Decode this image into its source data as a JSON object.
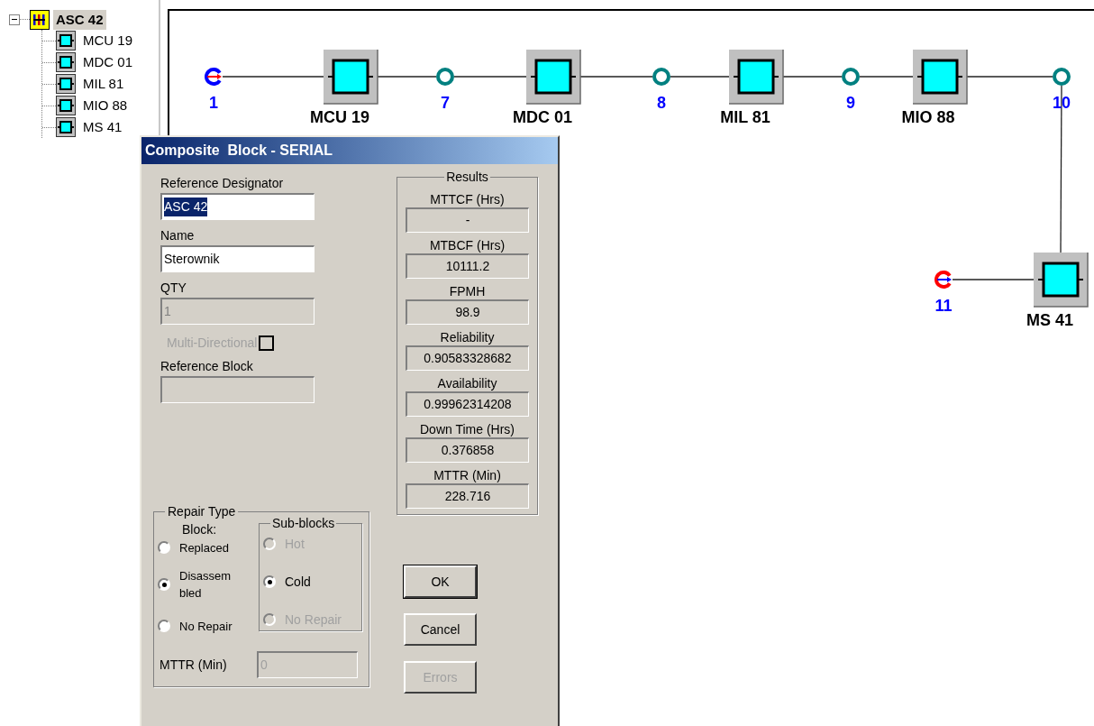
{
  "tree": {
    "label": "ASC 42",
    "expanded": true,
    "selected": true,
    "children": [
      {
        "label": "MCU 19",
        "selected": false
      },
      {
        "label": "MDC 01",
        "selected": false
      },
      {
        "label": "MIL 81",
        "selected": false
      },
      {
        "label": "MIO 88",
        "selected": false
      },
      {
        "label": "MS 41",
        "selected": false
      }
    ]
  },
  "diagram": {
    "nodes": [
      {
        "kind": "start",
        "label": "1"
      },
      {
        "kind": "block",
        "label": "MCU 19"
      },
      {
        "kind": "junction",
        "label": "7"
      },
      {
        "kind": "block",
        "label": "MDC 01"
      },
      {
        "kind": "junction",
        "label": "8"
      },
      {
        "kind": "block",
        "label": "MIL 81"
      },
      {
        "kind": "junction",
        "label": "9"
      },
      {
        "kind": "block",
        "label": "MIO 88"
      },
      {
        "kind": "junction",
        "label": "10"
      },
      {
        "kind": "block",
        "label": "MS 41"
      },
      {
        "kind": "end",
        "label": "11"
      }
    ]
  },
  "dialog": {
    "title": "Composite  Block - SERIAL",
    "fields": [
      {
        "kind": "text",
        "label": "Reference Designator",
        "value": "ASC 42",
        "highlighted": true,
        "disabled": false
      },
      {
        "kind": "text",
        "label": "Name",
        "value": "Sterownik",
        "highlighted": false,
        "disabled": false
      },
      {
        "kind": "text",
        "label": "QTY",
        "value": "1",
        "highlighted": false,
        "disabled": true
      },
      {
        "kind": "checkbox",
        "label": "Multi-Directional",
        "checked": false,
        "disabled": true
      },
      {
        "kind": "text",
        "label": "Reference Block",
        "disabled": true
      }
    ],
    "results": {
      "title": "Results",
      "items": [
        {
          "label": "MTTCF (Hrs)",
          "value": "-"
        },
        {
          "label": "MTBCF (Hrs)",
          "value": "10111.2"
        },
        {
          "label": "FPMH",
          "value": "98.9"
        },
        {
          "label": "Reliability",
          "value": "0.90583328682"
        },
        {
          "label": "Availability",
          "value": "0.99962314208"
        },
        {
          "label": "Down Time (Hrs)",
          "value": "0.376858"
        },
        {
          "label": "MTTR (Min)",
          "value": "228.716"
        }
      ]
    },
    "repair_type": {
      "title": "Repair Type",
      "block_label": "Block:",
      "options": [
        {
          "label": "Replaced",
          "selected": false
        },
        {
          "label": "Disassembled",
          "selected": true
        },
        {
          "label": "No Repair",
          "selected": false
        }
      ],
      "sub_blocks": {
        "title": "Sub-blocks",
        "options": [
          {
            "label": "Hot",
            "selected": false,
            "disabled": true
          },
          {
            "label": "Cold",
            "selected": true,
            "disabled": false
          },
          {
            "label": "No Repair",
            "selected": false,
            "disabled": true
          }
        ]
      },
      "mttr": {
        "label": "MTTR (Min)",
        "value": "0",
        "disabled": true
      }
    },
    "buttons": [
      {
        "label": "OK",
        "default": true,
        "disabled": false
      },
      {
        "label": "Cancel",
        "default": false,
        "disabled": false
      },
      {
        "label": "Errors",
        "default": false,
        "disabled": true
      }
    ]
  }
}
